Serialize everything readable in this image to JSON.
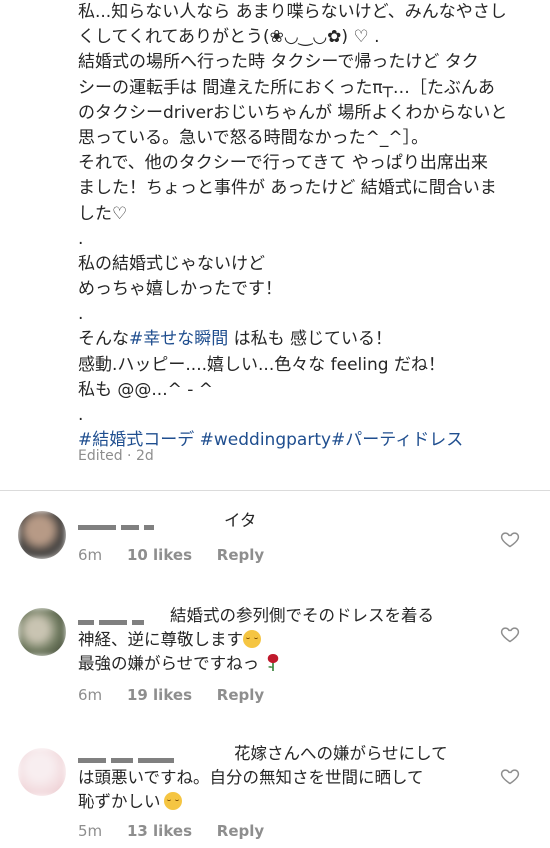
{
  "caption": {
    "lines": [
      "私...知らない人なら あまり喋らないけど、みんなやさし",
      "くしてくれてありがとう(❀◡‿◡✿) ♡ .",
      "結婚式の場所へ行った時 タクシーで帰ったけど タク",
      "シーの運転手は 間違えた所におくったπ┬…［たぶんあ",
      "のタクシーdriverおじいちゃんが 場所よくわからないと",
      "思っている。急いで怒る時間なかった^_^］。",
      "それで、他のタクシーで行ってきて やっぱり出席出来",
      "ました！ちょっと事件が あったけど 結婚式に間合いま",
      "した♡",
      ".",
      "私の結婚式じゃないけど",
      "めっちゃ嬉しかったです！",
      ".",
      "そんな",
      "は私も 感じている！",
      "感動.ハッピー....嬉しい...色々な feeling だね！",
      "私も @@...^ - ^",
      "."
    ],
    "hashtag_inline": "#幸せな瞬間",
    "hashtags": "#結婚式コーデ #weddingparty#パーティドレス",
    "edited": "Edited · 2d"
  },
  "comments": [
    {
      "name_visible": "イタ",
      "text_lines": [],
      "time": "6m",
      "likes": "10 likes",
      "reply": "Reply",
      "avatar_colors": [
        "#3b3a39",
        "#b79a86",
        "#e8ddd5"
      ]
    },
    {
      "name_visible": "",
      "text_lines": [
        "結婚式の参列側でそのドレスを着る",
        "神経、逆に尊敬します",
        "最強の嫌がらせですねっ"
      ],
      "time": "6m",
      "likes": "19 likes",
      "reply": "Reply",
      "avatar_colors": [
        "#6f7a5f",
        "#c9c4b2",
        "#3a4030"
      ]
    },
    {
      "name_visible": "",
      "text_lines": [
        "花嫁さんへの嫌がらせにして",
        "は頭悪いですね。自分の無知さを世間に晒して",
        "恥ずかしい"
      ],
      "time": "5m",
      "likes": "13 likes",
      "reply": "Reply",
      "avatar_colors": [
        "#f3dde0",
        "#e9c4c9",
        "#f8eef0"
      ]
    }
  ],
  "colors": {
    "text": "#262626",
    "hashtag": "#1f4e8f",
    "muted": "#8e8e8e",
    "divider": "#dbdbdb"
  },
  "icons": [
    "heart-outline-icon",
    "smiling-face-emoji",
    "rose-emoji"
  ]
}
